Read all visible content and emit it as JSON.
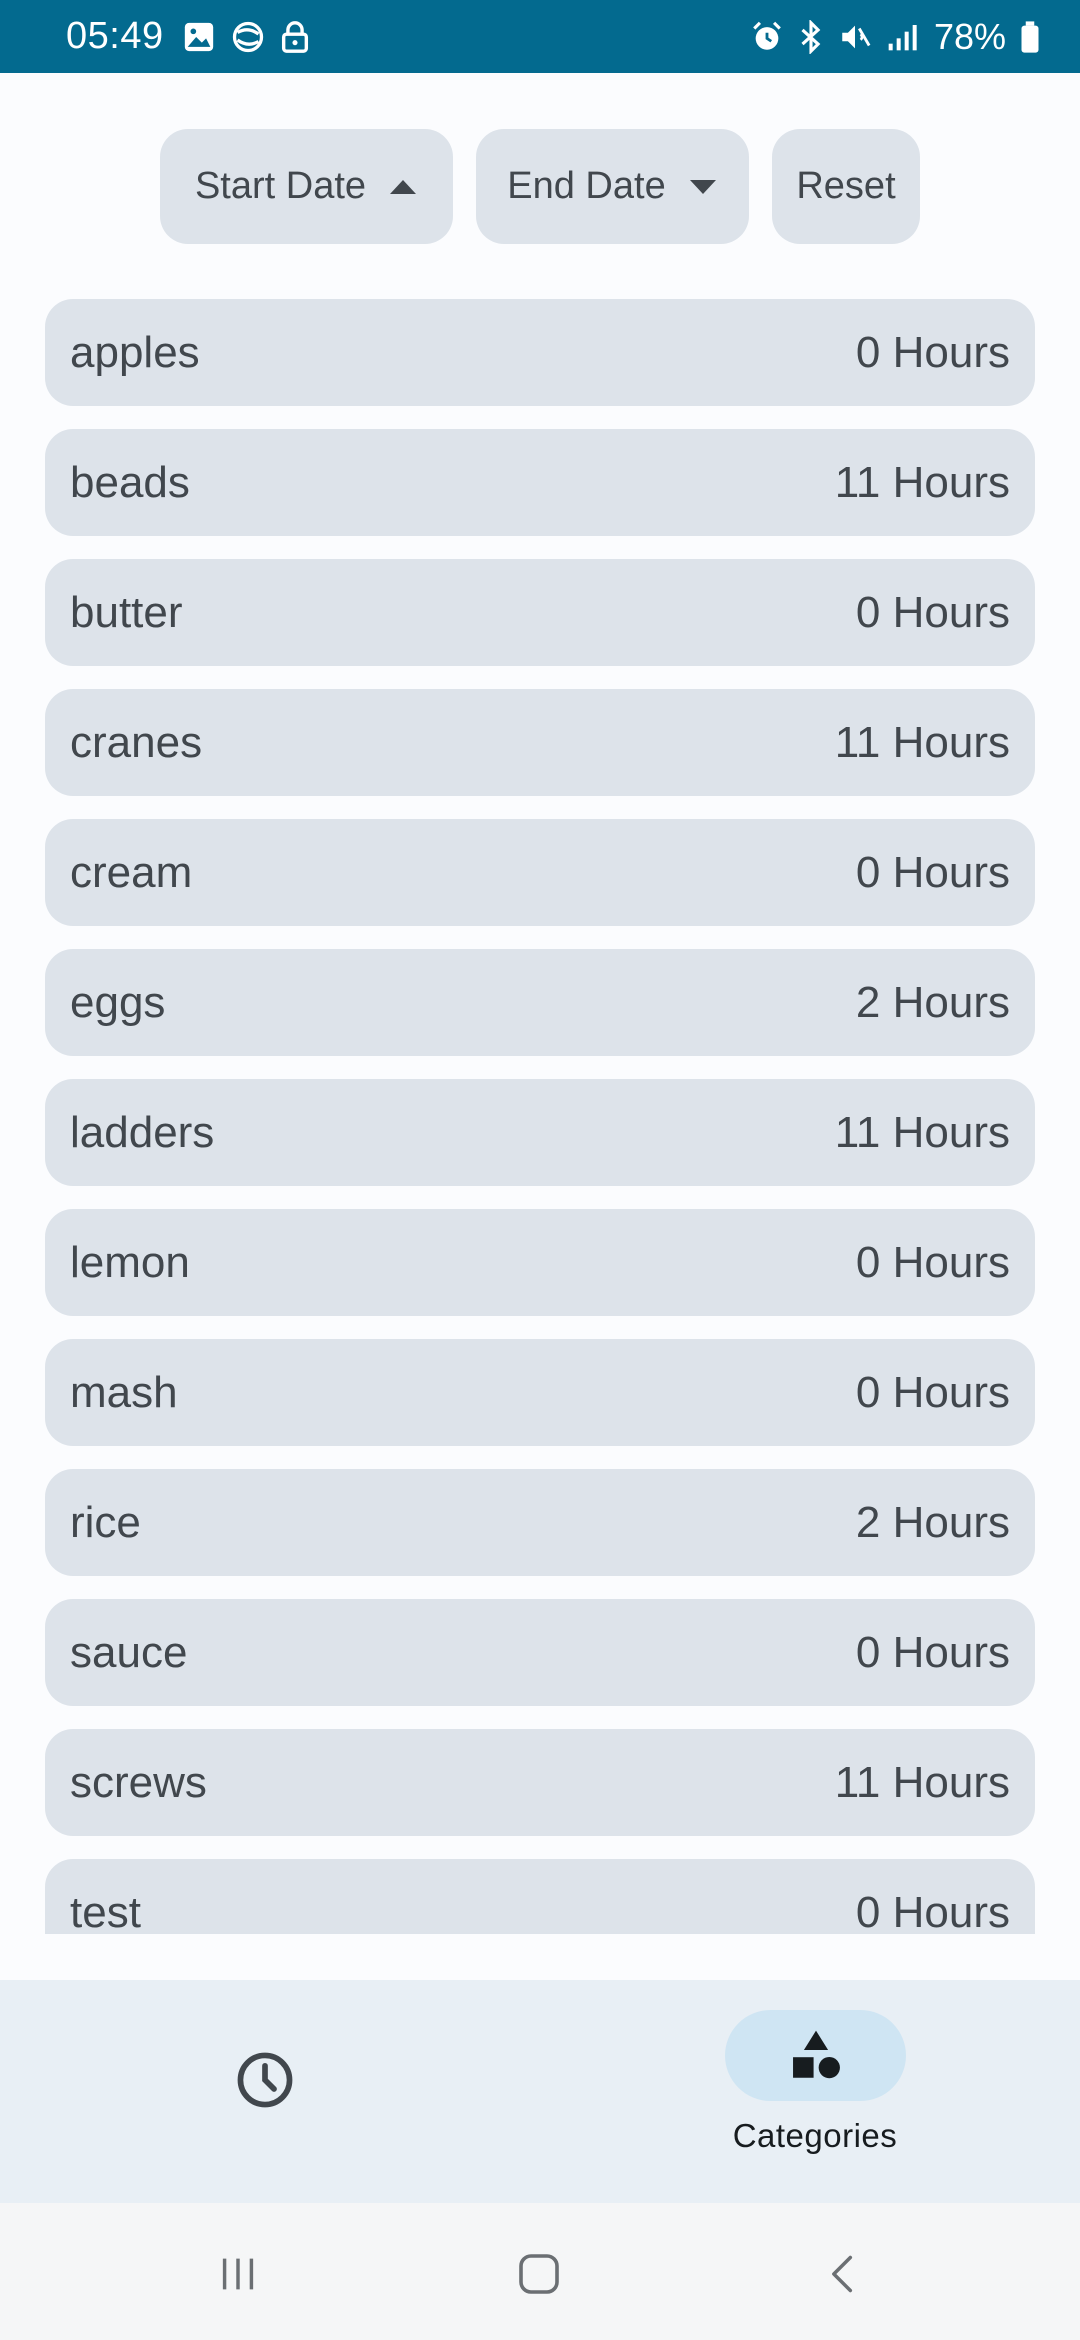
{
  "status_bar": {
    "time": "05:49",
    "battery": "78%",
    "background_color": "#036a8f",
    "left_icons": [
      "gallery-icon",
      "sync-icon",
      "lock-icon"
    ],
    "right_icons": [
      "alarm-icon",
      "bluetooth-icon",
      "mute-icon",
      "signal-icon",
      "battery-icon"
    ]
  },
  "filters": {
    "start_date_label": "Start Date",
    "start_date_icon": "caret-up-icon",
    "end_date_label": "End Date",
    "end_date_icon": "caret-down-icon",
    "reset_label": "Reset"
  },
  "categories": [
    {
      "name": "apples",
      "hours": "0 Hours"
    },
    {
      "name": "beads",
      "hours": "11 Hours"
    },
    {
      "name": "butter",
      "hours": "0 Hours"
    },
    {
      "name": "cranes",
      "hours": "11 Hours"
    },
    {
      "name": "cream",
      "hours": "0 Hours"
    },
    {
      "name": "eggs",
      "hours": "2 Hours"
    },
    {
      "name": "ladders",
      "hours": "11 Hours"
    },
    {
      "name": "lemon",
      "hours": "0 Hours"
    },
    {
      "name": "mash",
      "hours": "0 Hours"
    },
    {
      "name": "rice",
      "hours": "2 Hours"
    },
    {
      "name": "sauce",
      "hours": "0 Hours"
    },
    {
      "name": "screws",
      "hours": "11 Hours"
    },
    {
      "name": "test",
      "hours": "0 Hours"
    }
  ],
  "bottom_nav": {
    "history_icon": "clock-icon",
    "categories_icon": "shapes-icon",
    "categories_label": "Categories",
    "selected": "Categories",
    "accent_color": "#cfe5f3"
  },
  "system_nav": {
    "recents_icon": "recents-icon",
    "home_icon": "home-icon",
    "back_icon": "back-icon"
  }
}
